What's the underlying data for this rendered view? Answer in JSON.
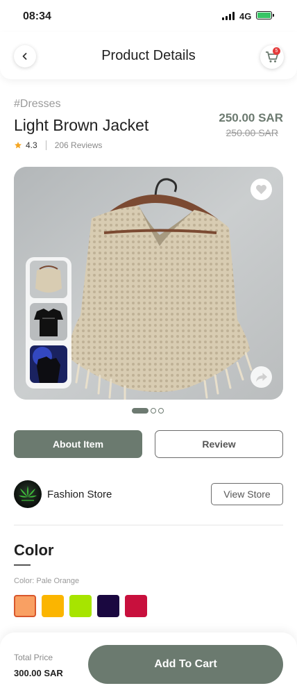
{
  "status_bar": {
    "time": "08:34",
    "network": "4G"
  },
  "header": {
    "title": "Product Details",
    "cart_count": "5"
  },
  "product": {
    "category": "#Dresses",
    "name": "Light Brown Jacket",
    "rating": "4.3",
    "reviews": "206 Reviews",
    "price": "250.00 SAR",
    "old_price": "250.00 SAR"
  },
  "gallery": {
    "image_count": 3,
    "active_index": 0
  },
  "tabs": {
    "about": "About Item",
    "review": "Review"
  },
  "store": {
    "name": "Fashion Store",
    "view_label": "View Store"
  },
  "color": {
    "title": "Color",
    "label": "Color: Pale Orange",
    "swatches": [
      "#f9a063",
      "#fbb500",
      "#a7e400",
      "#1a0840",
      "#c8103d"
    ],
    "selected": 0
  },
  "bottom": {
    "total_label": "Total Price",
    "total_value": "300.00 SAR",
    "add_to_cart": "Add To Cart"
  },
  "colors": {
    "accent": "#6b7a6f",
    "price": "#6c7a70",
    "star": "#f5a623"
  }
}
